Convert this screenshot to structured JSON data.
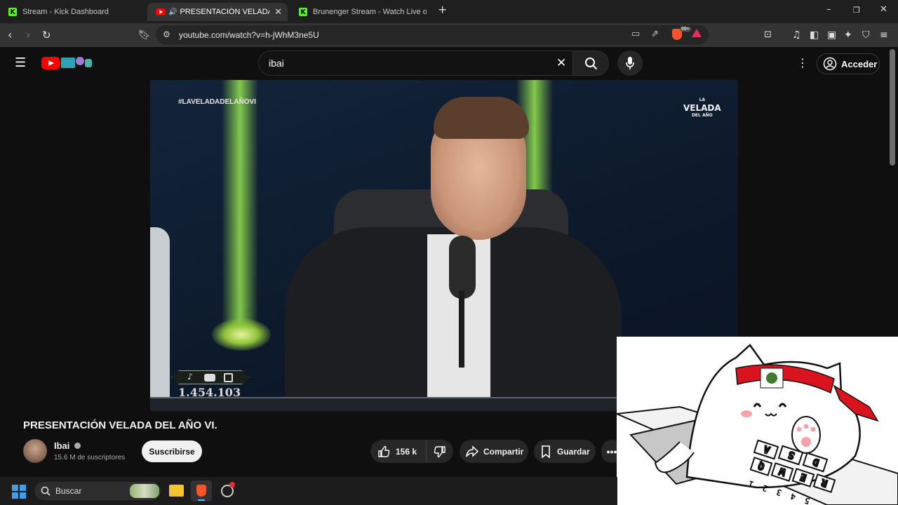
{
  "browser": {
    "tabs": [
      {
        "title": "Stream - Kick Dashboard",
        "active": false
      },
      {
        "title": "PRESENTACIÓN VELADA DEL",
        "active": true
      },
      {
        "title": "Brunenger Stream - Watch Live on Ki",
        "active": false
      }
    ],
    "url": "youtube.com/watch?v=h-jWhM3ne5U",
    "brave_badge": "99+"
  },
  "youtube": {
    "search_value": "ibai",
    "signin_label": "Acceder"
  },
  "video": {
    "hashtag": "#LAVELADADELAÑOVI",
    "logo_top": "LA",
    "logo_main": "VELADA",
    "logo_sub": "DEL AÑO",
    "viewer_count": "1.454.103"
  },
  "meta": {
    "title": "PRESENTACIÓN VELADA DEL AÑO VI.",
    "channel": "Ibai",
    "subscribers": "15.6 M de suscriptores",
    "subscribe_label": "Suscribirse",
    "likes": "156 k",
    "share_label": "Compartir",
    "save_label": "Guardar"
  },
  "taskbar": {
    "search_placeholder": "Buscar"
  },
  "overlay": {
    "keys": [
      "Q",
      "W",
      "E",
      "R",
      "A",
      "S",
      "D",
      "1",
      "2",
      "3",
      "4",
      "5"
    ]
  }
}
